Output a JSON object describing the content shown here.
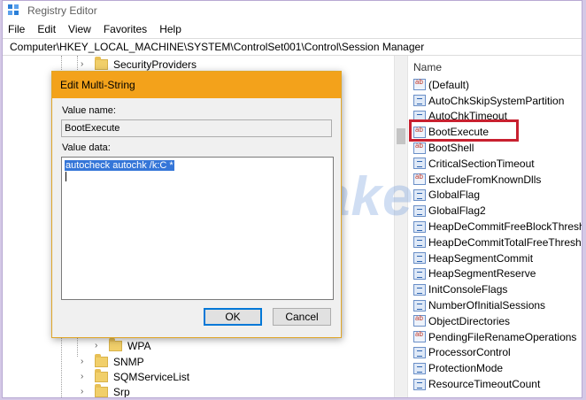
{
  "window": {
    "title": "Registry Editor"
  },
  "menu": [
    "File",
    "Edit",
    "View",
    "Favorites",
    "Help"
  ],
  "address": "Computer\\HKEY_LOCAL_MACHINE\\SYSTEM\\ControlSet001\\Control\\Session Manager",
  "tree": {
    "top_node": "SecurityProviders",
    "bottom_nodes": [
      "WPA",
      "SNMP",
      "SQMServiceList",
      "Srp"
    ]
  },
  "values_pane": {
    "column_header": "Name",
    "items": [
      {
        "name": "(Default)",
        "type": "string"
      },
      {
        "name": "AutoChkSkipSystemPartition",
        "type": "binary"
      },
      {
        "name": "AutoChkTimeout",
        "type": "binary"
      },
      {
        "name": "BootExecute",
        "type": "string"
      },
      {
        "name": "BootShell",
        "type": "string"
      },
      {
        "name": "CriticalSectionTimeout",
        "type": "binary"
      },
      {
        "name": "ExcludeFromKnownDlls",
        "type": "string"
      },
      {
        "name": "GlobalFlag",
        "type": "binary"
      },
      {
        "name": "GlobalFlag2",
        "type": "binary"
      },
      {
        "name": "HeapDeCommitFreeBlockThreshold",
        "type": "binary"
      },
      {
        "name": "HeapDeCommitTotalFreeThreshold",
        "type": "binary"
      },
      {
        "name": "HeapSegmentCommit",
        "type": "binary"
      },
      {
        "name": "HeapSegmentReserve",
        "type": "binary"
      },
      {
        "name": "InitConsoleFlags",
        "type": "binary"
      },
      {
        "name": "NumberOfInitialSessions",
        "type": "binary"
      },
      {
        "name": "ObjectDirectories",
        "type": "string"
      },
      {
        "name": "PendingFileRenameOperations",
        "type": "string"
      },
      {
        "name": "ProcessorControl",
        "type": "binary"
      },
      {
        "name": "ProtectionMode",
        "type": "binary"
      },
      {
        "name": "ResourceTimeoutCount",
        "type": "binary"
      }
    ]
  },
  "dialog": {
    "title": "Edit Multi-String",
    "value_name_label": "Value name:",
    "value_name": "BootExecute",
    "value_data_label": "Value data:",
    "value_data": "autocheck autochk /k:C *",
    "ok_label": "OK",
    "cancel_label": "Cancel"
  },
  "watermark": "TipsMake",
  "colors": {
    "dialog_title": "#f3a21b",
    "highlight": "#c8202f",
    "selection": "#3576d8"
  }
}
